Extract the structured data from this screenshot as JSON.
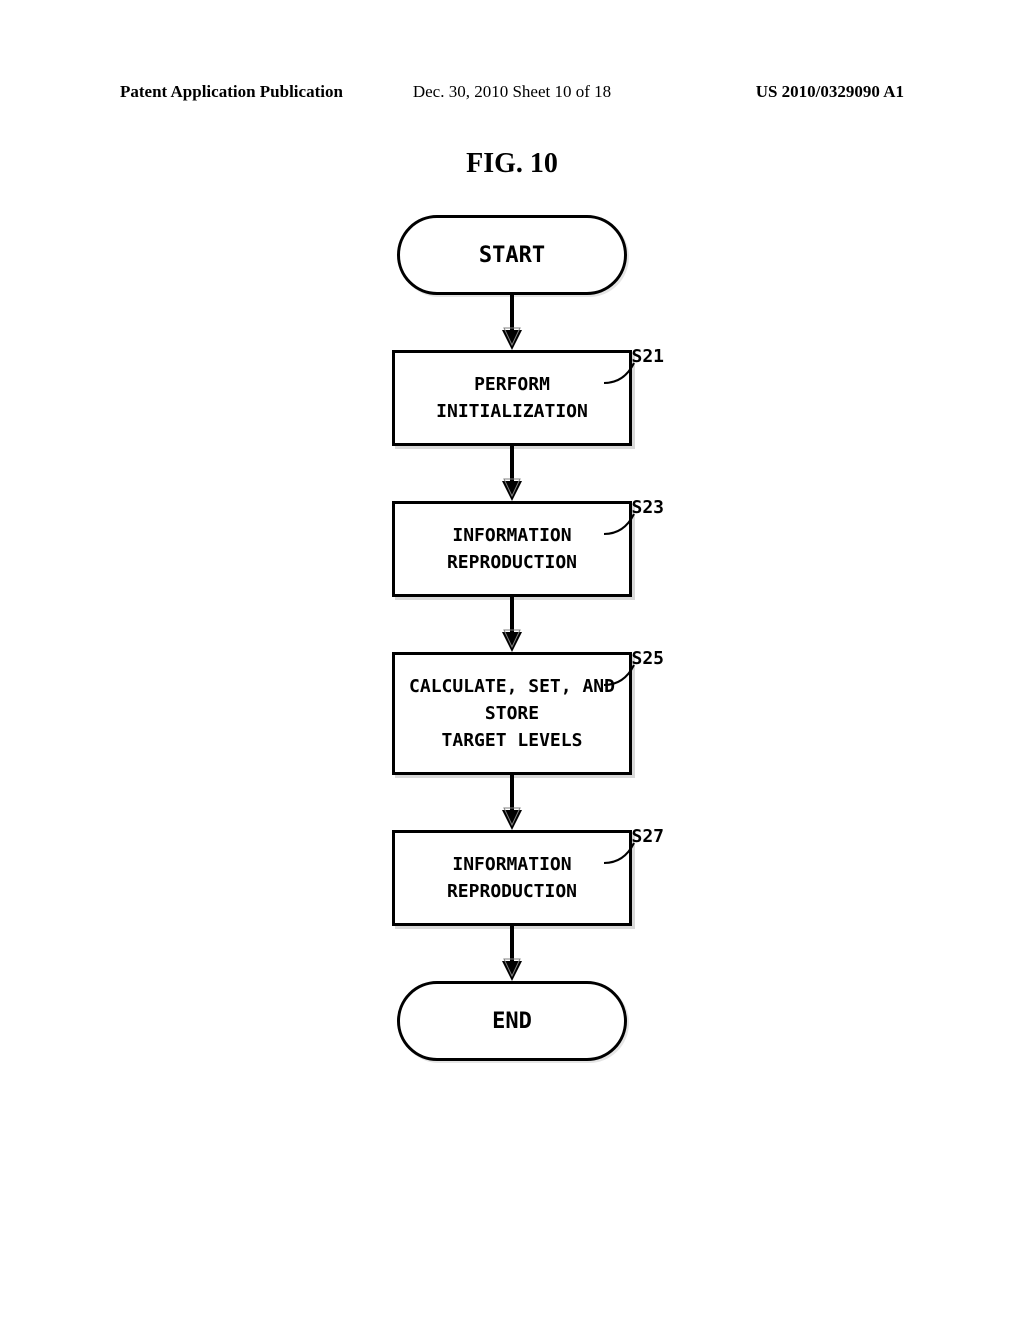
{
  "header": {
    "left": "Patent Application Publication",
    "center": "Dec. 30, 2010  Sheet 10 of 18",
    "right": "US 2010/0329090 A1"
  },
  "figure_title": "FIG. 10",
  "flowchart": {
    "start": "START",
    "end": "END",
    "steps": [
      {
        "text": "PERFORM\nINITIALIZATION",
        "label": "S21"
      },
      {
        "text": "INFORMATION\nREPRODUCTION",
        "label": "S23"
      },
      {
        "text": "CALCULATE, SET, AND\nSTORE\nTARGET LEVELS",
        "label": "S25"
      },
      {
        "text": "INFORMATION\nREPRODUCTION",
        "label": "S27"
      }
    ]
  },
  "chart_data": {
    "type": "flowchart",
    "title": "FIG. 10",
    "nodes": [
      {
        "id": "start",
        "type": "terminal",
        "label": "START"
      },
      {
        "id": "s21",
        "type": "process",
        "label": "PERFORM INITIALIZATION",
        "step": "S21"
      },
      {
        "id": "s23",
        "type": "process",
        "label": "INFORMATION REPRODUCTION",
        "step": "S23"
      },
      {
        "id": "s25",
        "type": "process",
        "label": "CALCULATE, SET, AND STORE TARGET LEVELS",
        "step": "S25"
      },
      {
        "id": "s27",
        "type": "process",
        "label": "INFORMATION REPRODUCTION",
        "step": "S27"
      },
      {
        "id": "end",
        "type": "terminal",
        "label": "END"
      }
    ],
    "edges": [
      {
        "from": "start",
        "to": "s21"
      },
      {
        "from": "s21",
        "to": "s23"
      },
      {
        "from": "s23",
        "to": "s25"
      },
      {
        "from": "s25",
        "to": "s27"
      },
      {
        "from": "s27",
        "to": "end"
      }
    ]
  }
}
